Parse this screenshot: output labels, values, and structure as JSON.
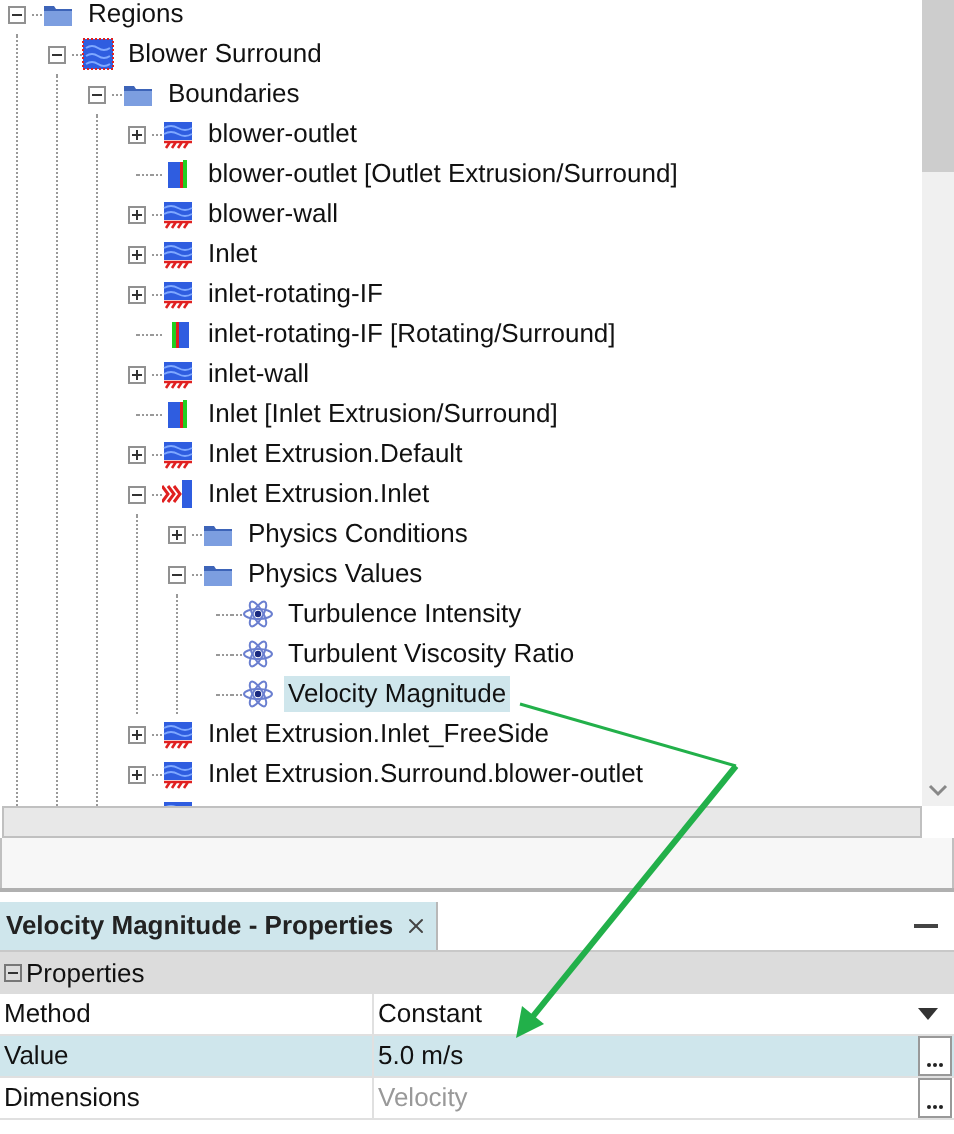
{
  "tree": [
    {
      "label": "Regions",
      "kind": "folder",
      "expanded": true,
      "selected": false,
      "children": [
        {
          "label": "Blower Surround",
          "kind": "region",
          "expanded": true,
          "selected": false,
          "children": [
            {
              "label": "Boundaries",
              "kind": "folder",
              "expanded": true,
              "selected": false,
              "children": [
                {
                  "label": "blower-outlet",
                  "kind": "boundary",
                  "expanded": false,
                  "selected": false
                },
                {
                  "label": "blower-outlet [Outlet Extrusion/Surround]",
                  "kind": "interface",
                  "selected": false
                },
                {
                  "label": "blower-wall",
                  "kind": "boundary",
                  "expanded": false,
                  "selected": false
                },
                {
                  "label": "Inlet",
                  "kind": "boundary",
                  "expanded": false,
                  "selected": false
                },
                {
                  "label": "inlet-rotating-IF",
                  "kind": "boundary",
                  "expanded": false,
                  "selected": false
                },
                {
                  "label": "inlet-rotating-IF [Rotating/Surround]",
                  "kind": "interface-reversed",
                  "selected": false
                },
                {
                  "label": "inlet-wall",
                  "kind": "boundary",
                  "expanded": false,
                  "selected": false
                },
                {
                  "label": "Inlet [Inlet Extrusion/Surround]",
                  "kind": "interface",
                  "selected": false
                },
                {
                  "label": "Inlet Extrusion.Default",
                  "kind": "boundary",
                  "expanded": false,
                  "selected": false
                },
                {
                  "label": "Inlet Extrusion.Inlet",
                  "kind": "inlet",
                  "expanded": true,
                  "selected": false,
                  "children": [
                    {
                      "label": "Physics Conditions",
                      "kind": "folder",
                      "expanded": false,
                      "selected": false
                    },
                    {
                      "label": "Physics Values",
                      "kind": "folder",
                      "expanded": true,
                      "selected": false,
                      "children": [
                        {
                          "label": "Turbulence Intensity",
                          "kind": "value",
                          "selected": false
                        },
                        {
                          "label": "Turbulent Viscosity Ratio",
                          "kind": "value",
                          "selected": false
                        },
                        {
                          "label": "Velocity Magnitude",
                          "kind": "value",
                          "selected": true
                        }
                      ]
                    }
                  ]
                },
                {
                  "label": "Inlet Extrusion.Inlet_FreeSide",
                  "kind": "boundary",
                  "expanded": false,
                  "selected": false
                },
                {
                  "label": "Inlet Extrusion.Surround.blower-outlet",
                  "kind": "boundary",
                  "expanded": false,
                  "selected": false
                },
                {
                  "kind": "boundary"
                }
              ]
            }
          ]
        }
      ]
    }
  ],
  "properties": {
    "tab": "Velocity Magnitude - Properties",
    "group": {
      "label": "Properties",
      "expanded": true
    },
    "rows": [
      {
        "name": "Method",
        "value": "Constant",
        "kind": "dropdown",
        "selected": false,
        "readonly": false
      },
      {
        "name": "Value",
        "value": "5.0 m/s",
        "kind": "editor",
        "selected": true,
        "readonly": false
      },
      {
        "name": "Dimensions",
        "value": "Velocity",
        "kind": "editor",
        "selected": false,
        "readonly": true
      }
    ]
  }
}
